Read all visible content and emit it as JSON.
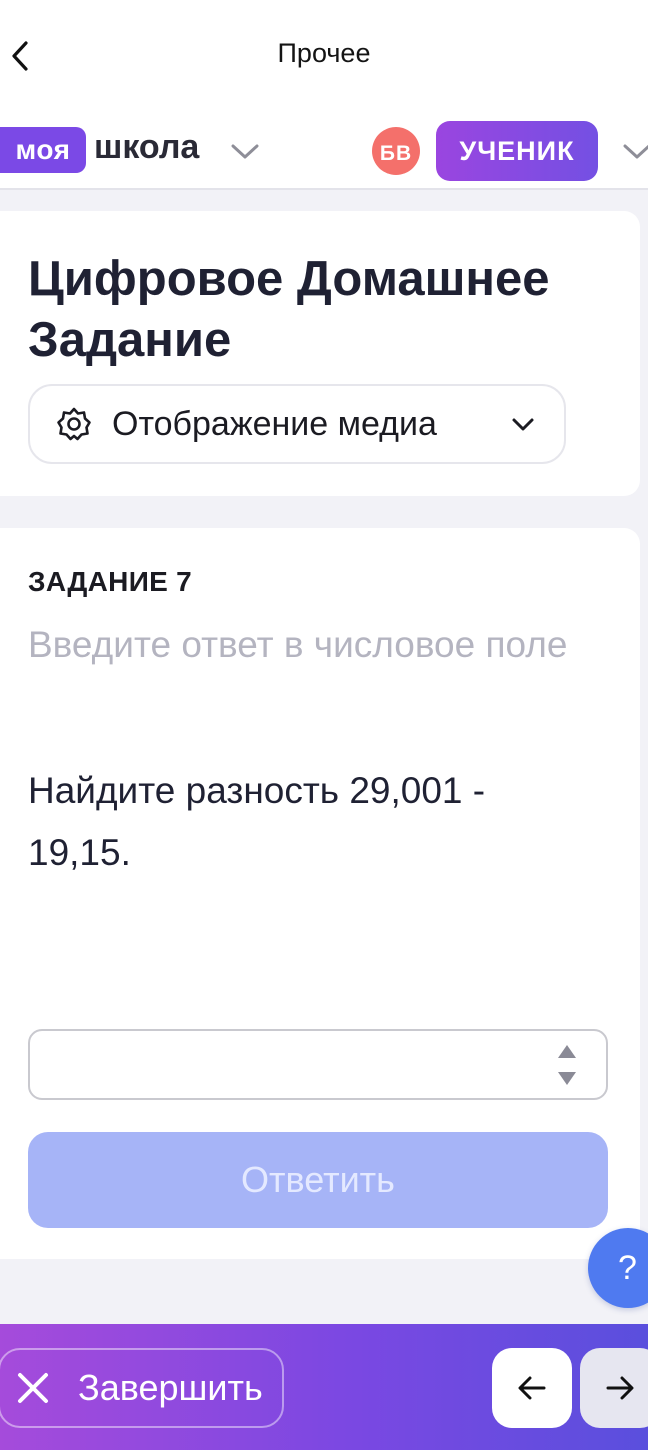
{
  "topbar": {
    "title": "Прочее"
  },
  "header": {
    "logo_pill": "моя",
    "logo_text": "школа",
    "avatar_initials": "БВ",
    "role": "УЧЕНИК"
  },
  "homework": {
    "title": "Цифровое Домашнее Задание",
    "media_select_label": "Отображение медиа"
  },
  "task": {
    "number": "ЗАДАНИЕ 7",
    "hint": "Введите ответ в числовое поле",
    "question": "Найдите разность 29,001 - 19,15.",
    "answer_value": "",
    "submit_label": "Ответить"
  },
  "help": {
    "label": "?"
  },
  "bottombar": {
    "finish_label": "Завершить"
  },
  "colors": {
    "brand_purple": "#7b49e6",
    "avatar": "#f4706b",
    "submit_disabled": "#a6b4f7",
    "help": "#4f7af0"
  },
  "icons": [
    "chevron-left-icon",
    "chevron-down-icon",
    "gear-icon",
    "close-icon",
    "arrow-left-icon",
    "arrow-right-icon",
    "question-icon"
  ]
}
